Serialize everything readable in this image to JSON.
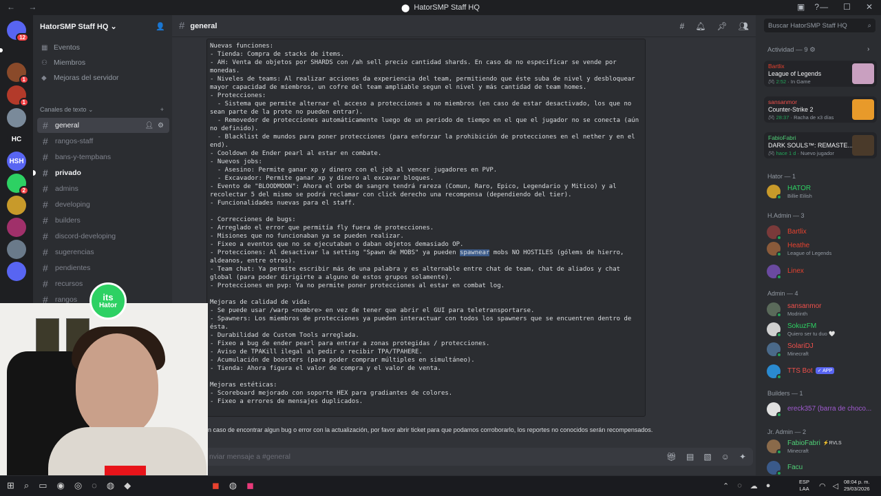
{
  "window": {
    "title": "HatorSMP Staff HQ",
    "nav_glyphs": "← →",
    "controls": [
      "—",
      "☐",
      "✕"
    ]
  },
  "server_list": [
    {
      "abbr": "",
      "badge": "12",
      "color": "#5865f2"
    },
    {
      "abbr": "",
      "badge": "1",
      "color": "#8a4a2a"
    },
    {
      "abbr": "",
      "badge": "1",
      "color": "#b33a2a"
    },
    {
      "abbr": "",
      "badge": "",
      "color": "#7a8a9a"
    },
    {
      "abbr": "HC",
      "badge": "",
      "color": "#1e1f22"
    },
    {
      "abbr": "HSH",
      "badge": "",
      "color": "#5865f2"
    },
    {
      "abbr": "",
      "badge": "2",
      "color": "#2dd163"
    },
    {
      "abbr": "",
      "badge": "",
      "color": "#c89a2a"
    },
    {
      "abbr": "",
      "badge": "",
      "color": "#a0306a"
    },
    {
      "abbr": "",
      "badge": "",
      "color": "#6a7a8a"
    },
    {
      "abbr": "",
      "badge": "",
      "color": "#5865f2"
    }
  ],
  "sidebar": {
    "server_name": "HatorSMP Staff HQ",
    "chevron": "⌄",
    "nav": [
      {
        "label": "Eventos",
        "icon": "calendar-icon"
      },
      {
        "label": "Miembros",
        "icon": "members-icon"
      },
      {
        "label": "Mejoras del servidor",
        "icon": "boost-icon"
      }
    ],
    "category": "Canales de texto",
    "category_add": "+",
    "channels": [
      {
        "name": "general",
        "state": "active"
      },
      {
        "name": "rangos-staff",
        "state": "normal"
      },
      {
        "name": "bans-y-tempbans",
        "state": "normal"
      },
      {
        "name": "privado",
        "state": "unread"
      },
      {
        "name": "admins",
        "state": "normal"
      },
      {
        "name": "developing",
        "state": "normal"
      },
      {
        "name": "builders",
        "state": "normal"
      },
      {
        "name": "discord-developing",
        "state": "normal"
      },
      {
        "name": "sugerencias",
        "state": "normal"
      },
      {
        "name": "pendientes",
        "state": "normal"
      },
      {
        "name": "recursos",
        "state": "normal"
      },
      {
        "name": "rangos",
        "state": "normal"
      }
    ]
  },
  "channel_header": {
    "hash": "#",
    "name": "general"
  },
  "message": {
    "code_before": "Nuevas funciones:\n- Tienda: Compra de stacks de items.\n- AH: Venta de objetos por SHARDS con /ah sell precio cantidad shards. En caso de no especificar se vende por monedas.\n- Niveles de teams: Al realizar acciones da experiencia del team, permitiendo que éste suba de nivel y desbloquear mayor capacidad de miembros, un cofre del team ampliable segun el nivel y más cantidad de team homes.\n- Protecciones:\n  - Sistema que permite alternar el acceso a protecciones a no miembros (en caso de estar desactivado, los que no sean parte de la prote no pueden entrar).\n  - Removedor de protecciones automáticamente luego de un periodo de tiempo en el que el jugador no se conecta (aún no definido).\n  - Blacklist de mundos para poner protecciones (para enforzar la prohibición de protecciones en el nether y en el end).\n- Cooldown de Ender pearl al estar en combate.\n- Nuevos jobs:\n  - Asesino: Permite ganar xp y dinero con el job al vencer jugadores en PVP.\n  - Excavador: Permite ganar xp y dinero al excavar bloques.\n- Evento de \"BLOODMOON\": Ahora el orbe de sangre tendrá rareza (Comun, Raro, Epico, Legendario y Mitico) y al recolectar 5 del mismo se podrá reclamar con click derecho una recompensa (dependiendo del tier).\n- Funcionalidades nuevas para el staff.\n\n- Correcciones de bugs:\n- Arreglado el error que permitía fly fuera de protecciones.\n- Misiones que no funcionaban ya se pueden realizar.\n- Fixeo a eventos que no se ejecutaban o daban objetos demasiado OP.\n- Protecciones: Al desactivar la setting \"Spawn de MOBS\" ya pueden ",
    "code_highlight": "spawnear",
    "code_after": " mobs NO HOSTILES (gólems de hierro, aldeanos, entre otros).\n- Team chat: Ya permite escribir más de una palabra y es alternable entre chat de team, chat de aliados y chat global (para poder dirigirte a alguno de estos grupos solamente).\n- Protecciones en pvp: Ya no permite poner protecciones al estar en combat log.\n\nMejoras de calidad de vida:\n- Se puede usar /warp <nombre> en vez de tener que abrir el GUI para teletransportarse.\n- Spawners: Los miembros de protecciones ya pueden interactuar con todos los spawners que se encuentren dentro de ésta.\n- Durabilidad de Custom Tools arreglada.\n- Fixeo a bug de ender pearl para entrar a zonas protegidas / protecciones.\n- Aviso de TPAKill ilegal al pedir o recibir TPA/TPAHERE.\n- Acumulación de boosters (para poder comprar múltiples en simultáneo).\n- Tienda: Ahora figura el valor de compra y el valor de venta.\n\nMejoras estéticas:\n- Scoreboard mejorado con soporte HEX para gradiantes de colores.\n- Fixeo a errores de mensajes duplicados.",
    "footer": "n caso de encontrar algun bug o error con la actualización, por favor abrir ticket para que podamos corroborarlo, los reportes no conocidos serán recompensados."
  },
  "composer": {
    "placeholder": "nviar mensaje a #general"
  },
  "search": {
    "placeholder": "Buscar HatorSMP Staff HQ",
    "icon": "⌕"
  },
  "activity": {
    "title": "Actividad — 9 ⚙",
    "arrow": "›",
    "cards": [
      {
        "user": "Bartlix",
        "game": "League of Legends",
        "time": "2:52",
        "detail": "In Game",
        "user_color": "#e8422f",
        "thumb": "#c9a0c0"
      },
      {
        "user": "sansanmor",
        "game": "Counter-Strike 2",
        "time": "28:37",
        "detail": "Racha de x3 días",
        "user_color": "#f0504b",
        "thumb": "#e89a2a"
      },
      {
        "user": "FabioFabri",
        "game": "DARK SOULS™: REMASTE...",
        "time": "hace 1 d",
        "detail": "Nuevo jugador",
        "user_color": "#4fd177",
        "thumb": "#4a3a2a"
      }
    ]
  },
  "member_groups": [
    {
      "title": "Hator — 1"
    },
    {
      "title": "H.Admin — 3"
    },
    {
      "title": "Admin — 4"
    },
    {
      "title": "Builders — 1"
    },
    {
      "title": "Jr. Admin — 2"
    }
  ],
  "members": [
    {
      "name": "HATOR",
      "status": "Billie Eilish",
      "color": "#2dd163",
      "avatar": "#c89a2a",
      "tag": ""
    },
    {
      "name": "Bartlix",
      "status": "",
      "color": "#e8422f",
      "avatar": "#7a3a3a",
      "tag": ""
    },
    {
      "name": "Heathe",
      "status": "League of Legends",
      "color": "#e8422f",
      "avatar": "#8a5a3a",
      "tag": ""
    },
    {
      "name": "Linex",
      "status": "",
      "color": "#e8422f",
      "avatar": "#6a4aa0",
      "tag": ""
    },
    {
      "name": "sansanmor",
      "status": "Modrinth",
      "color": "#f0504b",
      "avatar": "#5a6a5a",
      "tag": ""
    },
    {
      "name": "SokuzFM",
      "status": "Quiero ser tu duo 🤍",
      "color": "#2dd163",
      "avatar": "#d0d0d0",
      "tag": ""
    },
    {
      "name": "SolariDJ",
      "status": "Minecraft",
      "color": "#f0504b",
      "avatar": "#4a6a8a",
      "tag": ""
    },
    {
      "name": "TTS Bot",
      "status": "",
      "color": "#f0504b",
      "avatar": "#2a8ad0",
      "tag": "✓ APP"
    },
    {
      "name": "ereck357 (barra de choco...",
      "status": "",
      "color": "#a05ad0",
      "avatar": "#e0e0e0",
      "tag": ""
    },
    {
      "name": "FabioFabri",
      "status": "Minecraft",
      "color": "#4fd177",
      "avatar": "#8a6a4a",
      "tag": "⚡RVLS"
    },
    {
      "name": "Facu",
      "status": "",
      "color": "#4fd177",
      "avatar": "#3a5a8a",
      "tag": ""
    }
  ],
  "overlay": {
    "logo_line1": "its",
    "logo_line2": "Hator"
  },
  "taskbar": {
    "lang1": "ESP",
    "lang2": "LAA",
    "time": "08:04 p. m.",
    "date": "29/03/2026"
  }
}
